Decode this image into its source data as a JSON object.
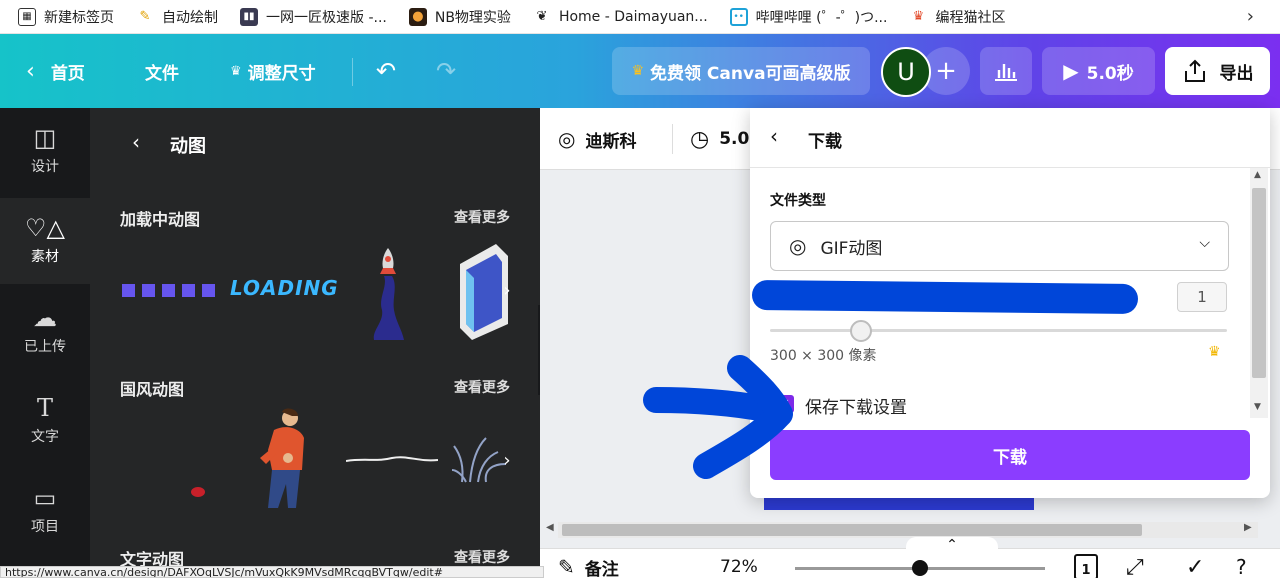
{
  "bookmarks": [
    {
      "label": "新建标签页",
      "icon": "new-tab-icon"
    },
    {
      "label": "自动绘制",
      "icon": "magic-pen-icon"
    },
    {
      "label": "一网一匠极速版 -...",
      "icon": "bars-icon"
    },
    {
      "label": "NB物理实验",
      "icon": "lab-icon"
    },
    {
      "label": "Home - Daimayuan...",
      "icon": "leaf-icon"
    },
    {
      "label": "哔哩哔哩 (゜-゜)つ...",
      "icon": "bilibili-icon"
    },
    {
      "label": "编程猫社区",
      "icon": "cat-icon"
    }
  ],
  "header": {
    "home": "首页",
    "file": "文件",
    "resize": "调整尺寸",
    "upgrade": "免费领 Canva可画高级版",
    "avatar_letter": "U",
    "play_time": "5.0秒",
    "export": "导出"
  },
  "leftnav": [
    {
      "label": "设计",
      "icon": "design-icon"
    },
    {
      "label": "素材",
      "icon": "elements-icon",
      "active": true
    },
    {
      "label": "已上传",
      "icon": "upload-cloud-icon"
    },
    {
      "label": "文字",
      "icon": "text-icon"
    },
    {
      "label": "项目",
      "icon": "folder-icon"
    }
  ],
  "panel": {
    "title": "动图",
    "sections": [
      {
        "title": "加载中动图",
        "more": "查看更多",
        "thumb_text": "LOADING"
      },
      {
        "title": "国风动图",
        "more": "查看更多"
      },
      {
        "title": "文字动图",
        "more": "查看更多"
      }
    ]
  },
  "editor": {
    "animation": "迪斯科",
    "duration": "5.0",
    "notes": "备注",
    "zoom": "72%",
    "page_number": "1"
  },
  "download": {
    "title": "下载",
    "file_type_label": "文件类型",
    "file_type_value": "GIF动图",
    "size_value": "1",
    "size_fraction": 0.2,
    "size_text": "300 × 300 像素",
    "save_settings_label": "保存下载设置",
    "save_settings_checked": true,
    "button": "下载"
  },
  "status_url": "https://www.canva.cn/design/DAFXOqLVSJc/mVuxQkK9MVsdMRcqqBVTqw/edit#",
  "colors": {
    "accent_purple": "#8b3dff",
    "redaction_blue": "#0046d9",
    "crown": "#f2b600"
  }
}
